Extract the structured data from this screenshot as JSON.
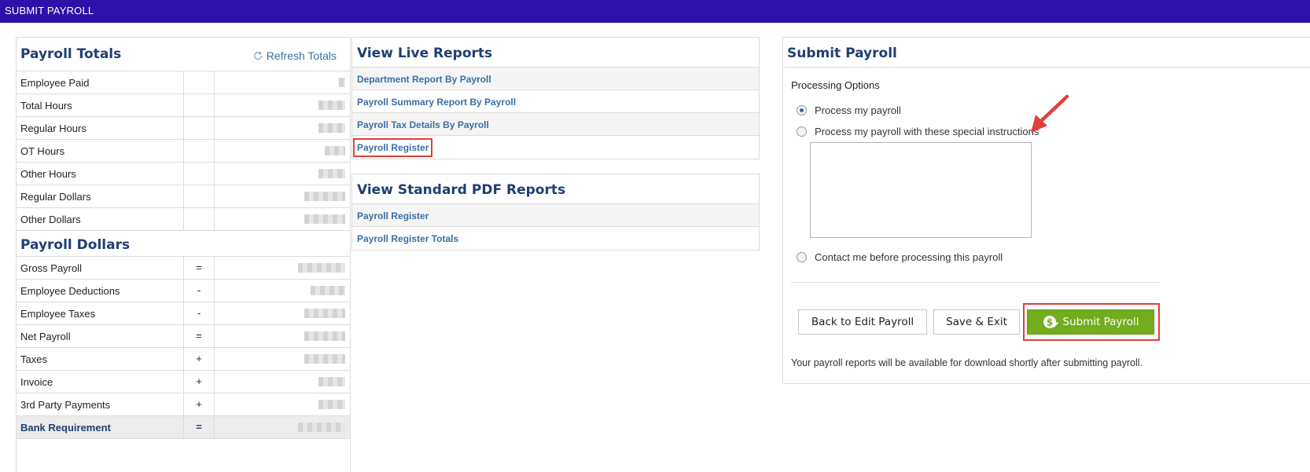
{
  "header": {
    "title": "SUBMIT PAYROLL"
  },
  "payroll_totals": {
    "title": "Payroll Totals",
    "refresh_label": "Refresh Totals",
    "rows": [
      {
        "label": "Employee Paid"
      },
      {
        "label": "Total Hours"
      },
      {
        "label": "Regular Hours"
      },
      {
        "label": "OT Hours"
      },
      {
        "label": "Other Hours"
      },
      {
        "label": "Regular Dollars"
      },
      {
        "label": "Other Dollars"
      }
    ]
  },
  "payroll_dollars": {
    "title": "Payroll Dollars",
    "rows": [
      {
        "label": "Gross Payroll",
        "op": "="
      },
      {
        "label": "Employee Deductions",
        "op": "-"
      },
      {
        "label": "Employee Taxes",
        "op": "-"
      },
      {
        "label": "Net Payroll",
        "op": "="
      },
      {
        "label": "Taxes",
        "op": "+"
      },
      {
        "label": "Invoice",
        "op": "+"
      },
      {
        "label": "3rd Party Payments",
        "op": "+"
      },
      {
        "label": "Bank Requirement",
        "op": "="
      }
    ]
  },
  "live_reports": {
    "title": "View Live Reports",
    "links": [
      "Department Report By Payroll",
      "Payroll Summary Report By Payroll",
      "Payroll Tax Details By Payroll",
      "Payroll Register"
    ]
  },
  "pdf_reports": {
    "title": "View Standard PDF Reports",
    "links": [
      "Payroll Register",
      "Payroll Register Totals"
    ]
  },
  "submit_panel": {
    "title": "Submit Payroll",
    "processing_label": "Processing Options",
    "options": [
      "Process my payroll",
      "Process my payroll with these special instructions",
      "Contact me before processing this payroll"
    ],
    "selected_option": 0,
    "instructions_value": "",
    "buttons": {
      "back": "Back to Edit Payroll",
      "save": "Save & Exit",
      "submit": "Submit Payroll"
    },
    "footnote": "Your payroll reports will be available for download shortly after submitting payroll."
  },
  "colors": {
    "header_bg": "#2e11a8",
    "title_text": "#1e3f73",
    "link_text": "#3a6fa5",
    "submit_bg": "#72ad1e",
    "annotation_red": "#e0403c"
  }
}
